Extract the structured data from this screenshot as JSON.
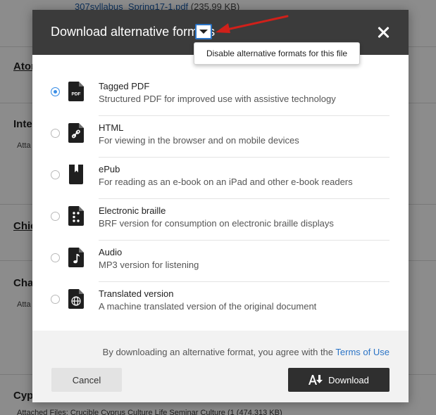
{
  "background": {
    "top_file_name": "307syllabus_Spring17-1.pdf",
    "top_file_size": "(235.99 KB)",
    "headings": [
      "Ator",
      "Inte",
      "Chic",
      "Cha",
      "Cyp"
    ],
    "sub_labels": [
      "Atta",
      "Atta"
    ],
    "bottom_text": "Attached Files: Crucible  Cyprus Culture Life Seminar Culture (1 (474.313 KB)"
  },
  "modal": {
    "title": "Download alternative formats",
    "dropdown_menu_item": "Disable alternative formats for this file",
    "options": [
      {
        "title": "Tagged PDF",
        "description": "Structured PDF for improved use with assistive technology",
        "icon": "pdf-file-icon",
        "icon_label": "PDF",
        "selected": true
      },
      {
        "title": "HTML",
        "description": "For viewing in the browser and on mobile devices",
        "icon": "link-file-icon",
        "selected": false
      },
      {
        "title": "ePub",
        "description": "For reading as an e-book on an iPad and other e-book readers",
        "icon": "book-icon",
        "selected": false
      },
      {
        "title": "Electronic braille",
        "description": "BRF version for consumption on electronic braille displays",
        "icon": "braille-file-icon",
        "selected": false
      },
      {
        "title": "Audio",
        "description": "MP3 version for listening",
        "icon": "audio-file-icon",
        "selected": false
      },
      {
        "title": "Translated version",
        "description": "A machine translated version of the original document",
        "icon": "globe-file-icon",
        "selected": false
      }
    ],
    "footer": {
      "terms_prefix": "By downloading an alternative format, you agree with the",
      "terms_link": "Terms of Use",
      "cancel_label": "Cancel",
      "download_label": "Download"
    }
  },
  "colors": {
    "header_bg": "#3b3b3b",
    "accent_blue": "#2b74c6",
    "annotation_red": "#d0201a",
    "download_bg": "#2f2f2f"
  }
}
